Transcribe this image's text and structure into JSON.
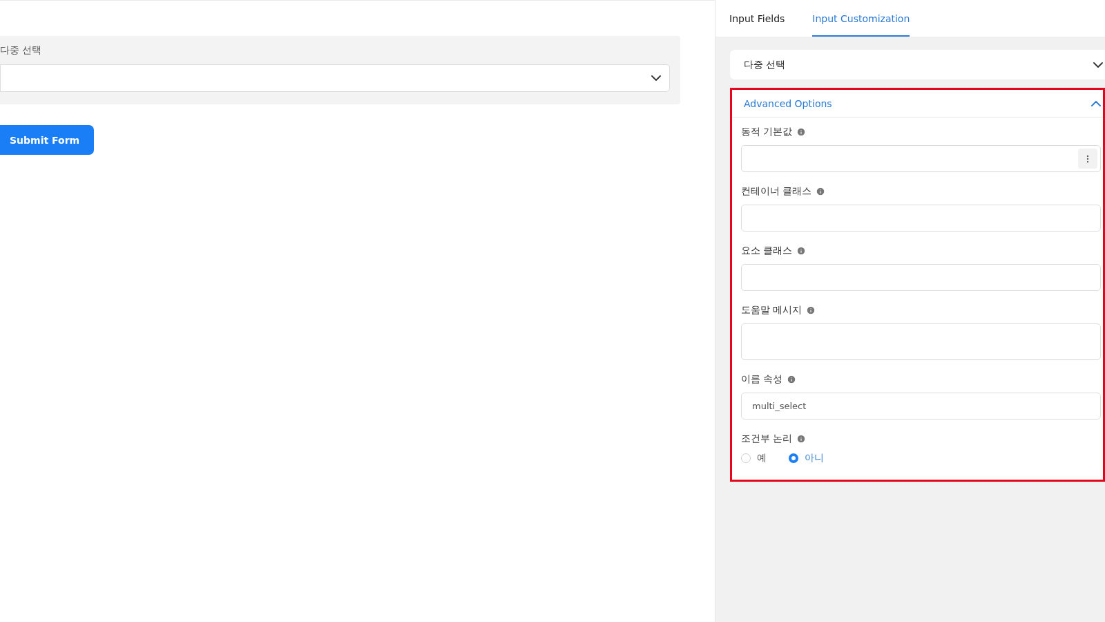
{
  "form": {
    "field_label": "다중 선택",
    "submit": "Submit Form"
  },
  "tabs": [
    {
      "label": "Input Fields",
      "selected": false
    },
    {
      "label": "Input Customization",
      "selected": true
    }
  ],
  "field_card": {
    "title": "다중 선택",
    "expanded": false
  },
  "advanced": {
    "title": "Advanced Options",
    "expanded": true,
    "fields": [
      {
        "kind": "menu-input",
        "label": "동적 기본값"
      },
      {
        "kind": "input",
        "label": "컨테이너 클래스"
      },
      {
        "kind": "input",
        "label": "요소 클래스"
      },
      {
        "kind": "textarea",
        "label": "도움말 메시지"
      },
      {
        "kind": "input",
        "label": "이름 속성",
        "value": "multi_select"
      },
      {
        "kind": "radio",
        "label": "조건부 논리",
        "options": [
          {
            "label": "예",
            "selected": false
          },
          {
            "label": "아니",
            "selected": true
          }
        ]
      }
    ]
  }
}
